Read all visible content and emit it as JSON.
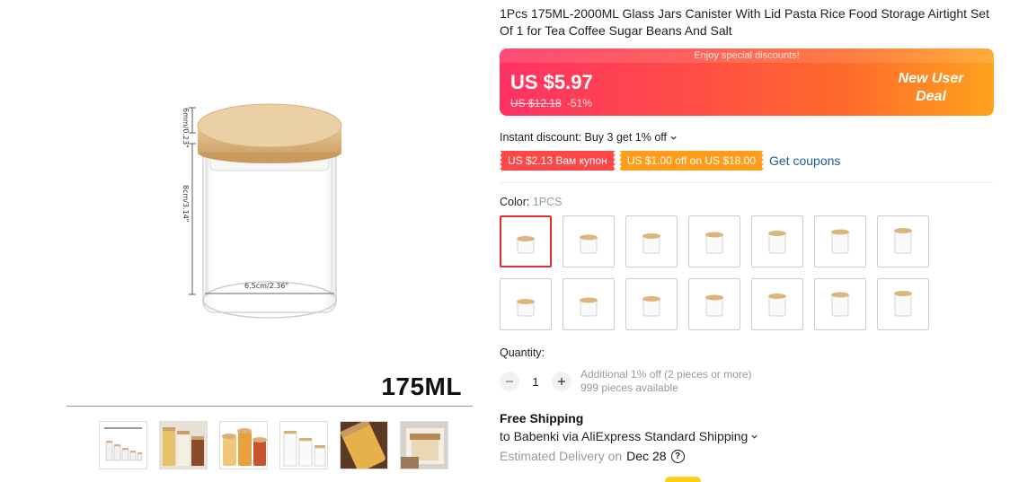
{
  "gallery": {
    "capacity_label": "175ML",
    "dimensions": {
      "lid_height": "6mm/0.23\"",
      "body_height": "8cm/3.14\"",
      "width": "6.5cm/2.36\""
    },
    "thumbnails": [
      {
        "name": "size-chart-thumb"
      },
      {
        "name": "kitchen-jars-thumb"
      },
      {
        "name": "filled-jars-thumb"
      },
      {
        "name": "empty-jars-thumb"
      },
      {
        "name": "pasta-jar-thumb"
      },
      {
        "name": "jar-in-use-thumb"
      }
    ]
  },
  "product": {
    "title": "1Pcs 175ML-2000ML Glass Jars Canister With Lid Pasta Rice Food Storage Airtight Set Of 1 for Tea Coffee Sugar Beans And Salt",
    "promo_strip": "Enjoy special discounts!",
    "price_current": "US $5.97",
    "price_original": "US $12.18",
    "price_discount": "-51%",
    "new_user_deal": "New User Deal",
    "instant_discount": "Instant discount: Buy 3 get 1% off",
    "coupons": [
      "US $2.13 Вам купон",
      "US $1.00 off on US $18.00"
    ],
    "get_coupons": "Get coupons",
    "color_label": "Color: ",
    "color_selected": "1PCS",
    "swatch_count": 14,
    "selected_swatch": 0,
    "quantity_label": "Quantity:",
    "quantity": "1",
    "quantity_note": "Additional 1% off (2 pieces or more)",
    "available": "999 pieces available",
    "free_shipping": "Free Shipping",
    "ship_to": "to Babenki via AliExpress Standard Shipping",
    "delivery_label": "Estimated Delivery on",
    "delivery_date": "Dec 28"
  },
  "colors": {
    "accent_red": "#ff4747",
    "coupon_orange": "#ff9c1a",
    "link_blue": "#1a5c9b",
    "selected_border": "#e0312e"
  },
  "icons": {
    "chevron": "chevron-down-icon",
    "minus": "minus-icon",
    "plus": "plus-icon",
    "help": "help-icon"
  }
}
